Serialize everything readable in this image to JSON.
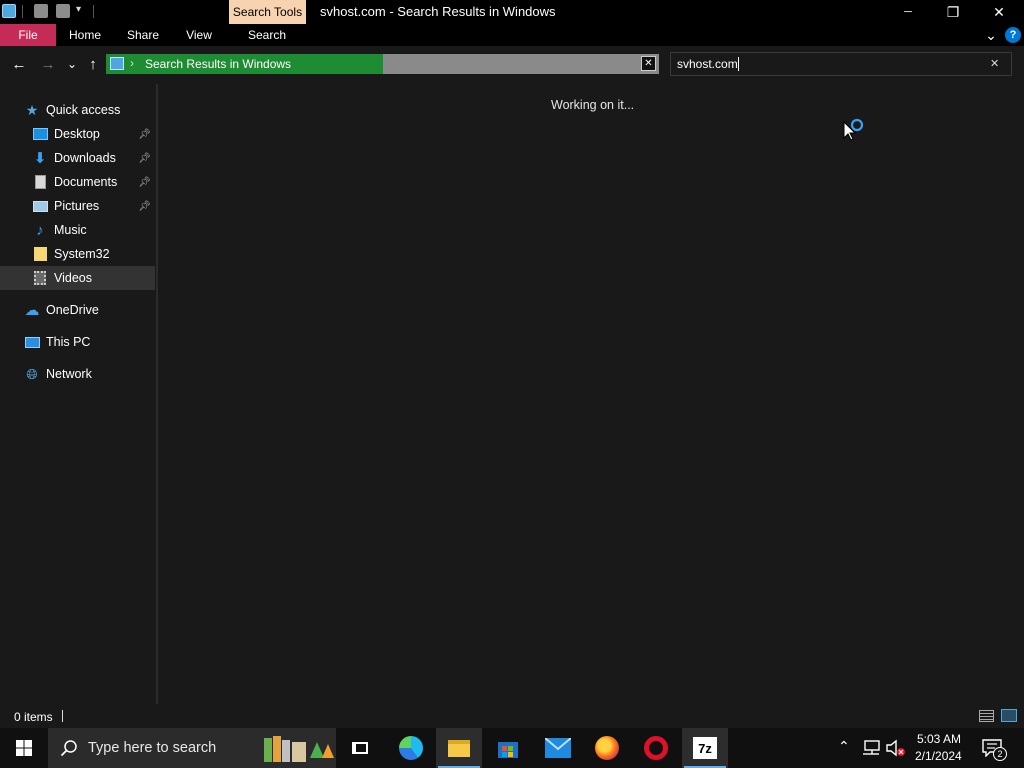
{
  "window": {
    "title": "svhost.com - Search Results in Windows",
    "contextual_tab": "Search Tools",
    "minimize_glyph": "─",
    "restore_glyph": "❐",
    "close_glyph": "✕"
  },
  "ribbon": {
    "tabs": [
      "File",
      "Home",
      "Share",
      "View",
      "Search"
    ],
    "help_glyph": "?",
    "expand_glyph": "⌄"
  },
  "nav": {
    "back_glyph": "←",
    "forward_glyph": "→",
    "recent_glyph": "⌄",
    "up_glyph": "↑",
    "address_separator": "›",
    "address_text": "Search Results in Windows",
    "address_progress": 0.5,
    "stop_glyph": "✕",
    "search_value": "svhost.com",
    "search_clear_glyph": "✕"
  },
  "sidebar": {
    "quick_access": "Quick access",
    "items": [
      {
        "label": "Desktop",
        "icon": "desktop-icon",
        "pinned": true
      },
      {
        "label": "Downloads",
        "icon": "downloads-icon",
        "pinned": true
      },
      {
        "label": "Documents",
        "icon": "documents-icon",
        "pinned": true
      },
      {
        "label": "Pictures",
        "icon": "pictures-icon",
        "pinned": true
      },
      {
        "label": "Music",
        "icon": "music-icon",
        "pinned": false
      },
      {
        "label": "System32",
        "icon": "folder-icon",
        "pinned": false
      },
      {
        "label": "Videos",
        "icon": "videos-icon",
        "pinned": false,
        "selected": true
      }
    ],
    "onedrive": "OneDrive",
    "this_pc": "This PC",
    "network": "Network"
  },
  "content": {
    "status_message": "Working on it..."
  },
  "statusbar": {
    "item_count": "0 items"
  },
  "taskbar": {
    "search_placeholder": "Type here to search",
    "time": "5:03 AM",
    "date": "2/1/2024",
    "notification_count": "2",
    "seven_zip_label": "7z"
  },
  "colors": {
    "accent_blue": "#0078d7",
    "progress_green": "#1e8c32",
    "file_tab_red": "#c42b57",
    "search_tools_tab": "#f8d3b0",
    "background": "#191919",
    "selected_item": "#333333"
  }
}
